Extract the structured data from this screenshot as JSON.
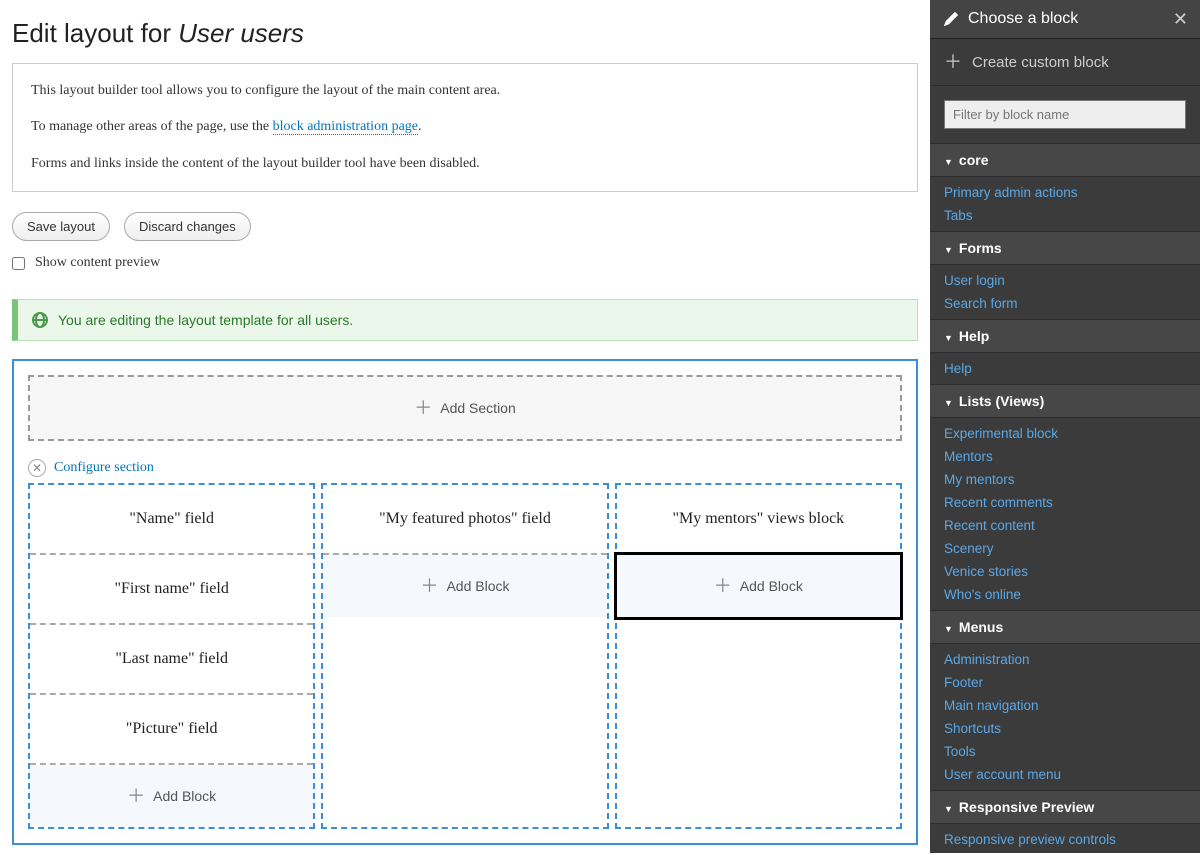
{
  "header": {
    "title_prefix": "Edit layout for ",
    "title_em": "User users"
  },
  "info": {
    "p1": "This layout builder tool allows you to configure the layout of the main content area.",
    "p2a": "To manage other areas of the page, use the ",
    "p2_link": "block administration page",
    "p2b": ".",
    "p3": "Forms and links inside the content of the layout builder tool have been disabled."
  },
  "actions": {
    "save": "Save layout",
    "discard": "Discard changes"
  },
  "preview": {
    "label": "Show content preview"
  },
  "status": {
    "text": "You are editing the layout template for all users."
  },
  "layout": {
    "add_section": "Add Section",
    "configure": "Configure section",
    "add_block": "Add Block",
    "cols": [
      {
        "blocks": [
          "\"Name\" field",
          "\"First name\" field",
          "\"Last name\" field",
          "\"Picture\" field"
        ]
      },
      {
        "blocks": [
          "\"My featured photos\" field"
        ]
      },
      {
        "blocks": [
          "\"My mentors\" views block"
        ]
      }
    ]
  },
  "sidebar": {
    "title": "Choose a block",
    "create": "Create custom block",
    "filter_placeholder": "Filter by block name",
    "categories": [
      {
        "name": "core",
        "items": [
          "Primary admin actions",
          "Tabs"
        ]
      },
      {
        "name": "Forms",
        "items": [
          "User login",
          "Search form"
        ]
      },
      {
        "name": "Help",
        "items": [
          "Help"
        ]
      },
      {
        "name": "Lists (Views)",
        "items": [
          "Experimental block",
          "Mentors",
          "My mentors",
          "Recent comments",
          "Recent content",
          "Scenery",
          "Venice stories",
          "Who's online"
        ]
      },
      {
        "name": "Menus",
        "items": [
          "Administration",
          "Footer",
          "Main navigation",
          "Shortcuts",
          "Tools",
          "User account menu"
        ]
      },
      {
        "name": "Responsive Preview",
        "items": [
          "Responsive preview controls"
        ]
      }
    ]
  }
}
